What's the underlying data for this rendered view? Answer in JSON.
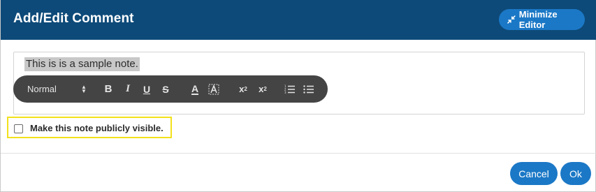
{
  "dialog": {
    "title": "Add/Edit Comment",
    "minimize_label": "Minimize Editor"
  },
  "editor": {
    "content": "This is is a sample note.",
    "toolbar": {
      "format_value": "Normal",
      "bold_label": "B",
      "italic_label": "I",
      "underline_label": "U",
      "strike_label": "S",
      "color_label": "A",
      "subscript_label": "x",
      "subscript_mark": "2",
      "superscript_label": "x",
      "superscript_mark": "2",
      "icons": [
        "bold-icon",
        "italic-icon",
        "underline-icon",
        "strikethrough-icon",
        "font-color-icon",
        "background-color-icon",
        "subscript-icon",
        "superscript-icon",
        "ordered-list-icon",
        "bullet-list-icon"
      ]
    }
  },
  "visibility": {
    "label": "Make this note publicly visible.",
    "checked": false
  },
  "footer": {
    "cancel_label": "Cancel",
    "ok_label": "Ok"
  },
  "colors": {
    "header_bg": "#0d4a79",
    "button_bg": "#1b78c6",
    "toolbar_bg": "#444444",
    "highlight_border": "#f2e11c"
  }
}
